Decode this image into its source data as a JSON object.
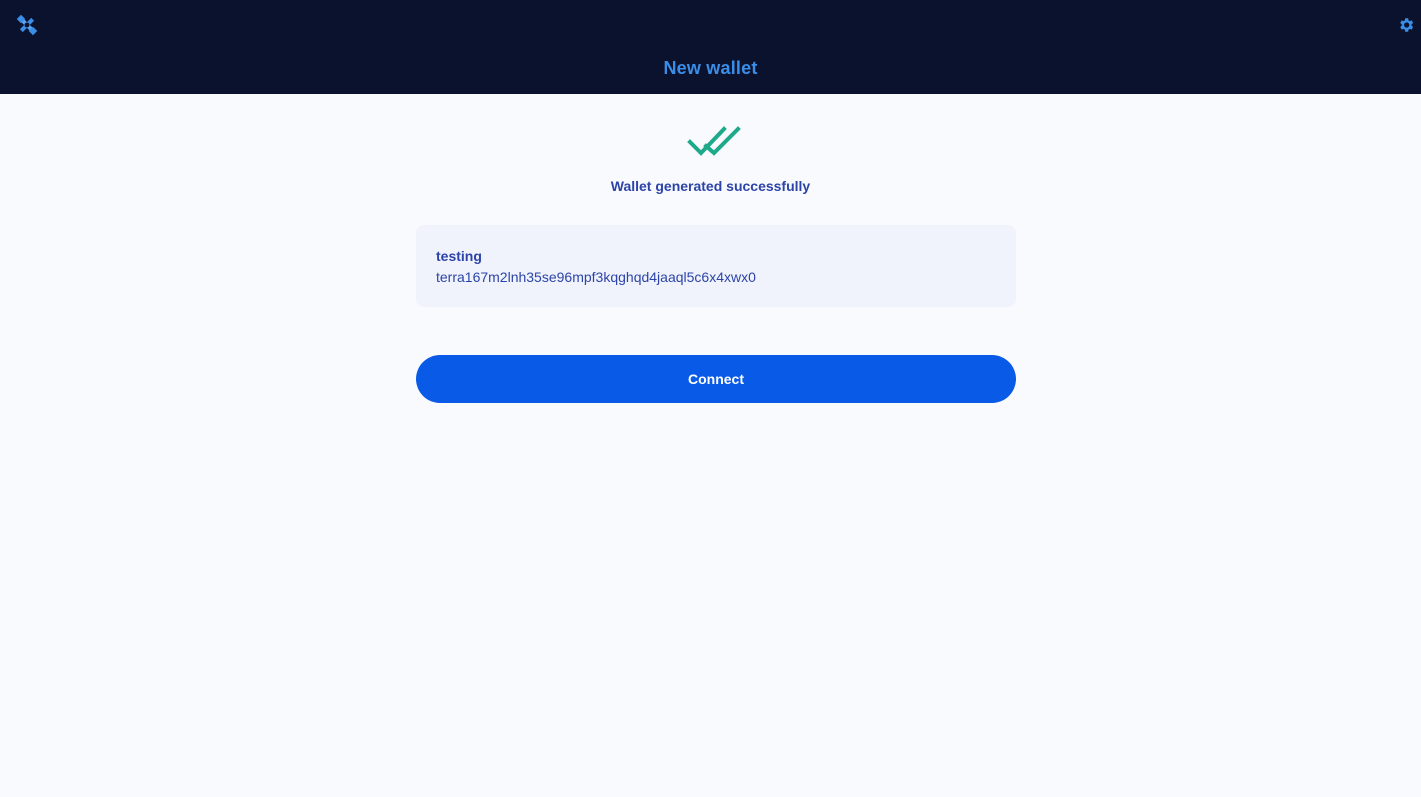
{
  "header": {
    "title": "New wallet",
    "logo_icon": "satellite-icon",
    "settings_icon": "gear-icon"
  },
  "status": {
    "icon": "double-check-icon",
    "message": "Wallet generated successfully"
  },
  "wallet": {
    "name": "testing",
    "address": "terra167m2lnh35se96mpf3kqghqd4jaaql5c6x4xwx0"
  },
  "actions": {
    "connect_label": "Connect"
  },
  "colors": {
    "header_bg": "#0b122d",
    "title": "#3b8ee8",
    "text": "#2c44a8",
    "success": "#1fa98b",
    "primary": "#0a5ae8",
    "card_bg": "#f0f3fb",
    "page_bg": "#f9fafe"
  }
}
